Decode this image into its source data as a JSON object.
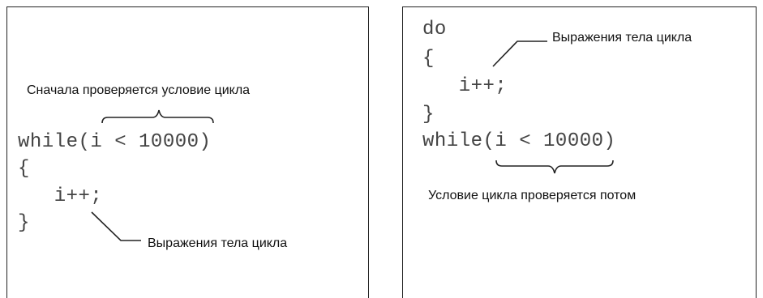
{
  "left_panel": {
    "annotation_top": "Сначала проверяется условие цикла",
    "code_lines": [
      "while(i < 10000)",
      "{",
      "   i++;",
      "}"
    ],
    "annotation_bottom": "Выражения тела цикла"
  },
  "right_panel": {
    "code_lines": [
      "do",
      "{",
      "   i++;",
      "}",
      "while(i < 10000)"
    ],
    "annotation_top": "Выражения тела цикла",
    "annotation_bottom": "Условие цикла проверяется потом"
  }
}
